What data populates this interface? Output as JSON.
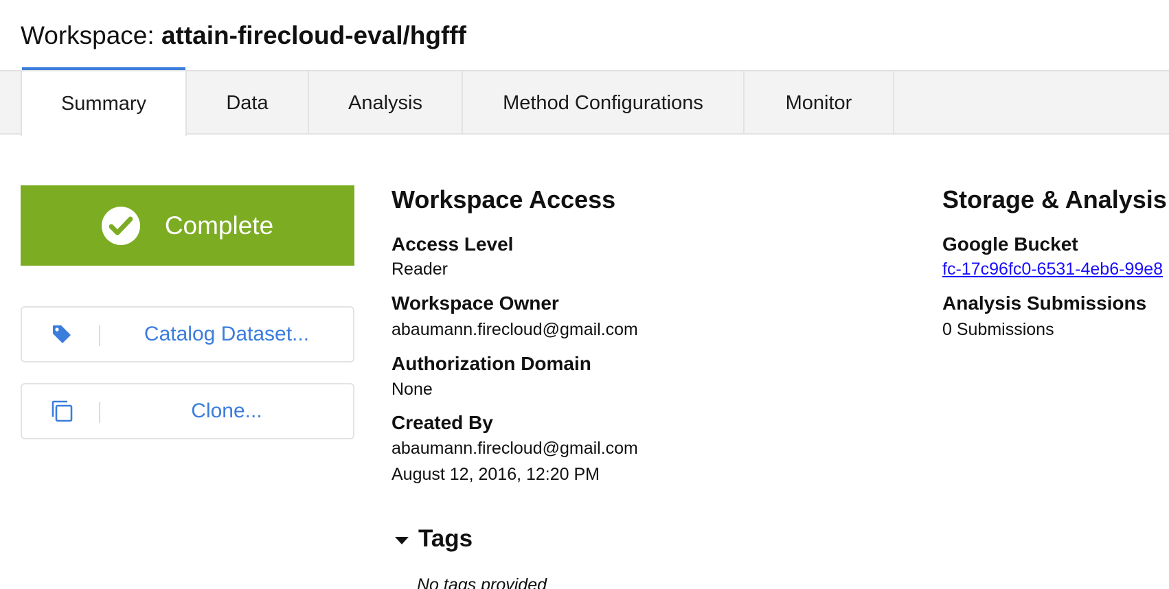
{
  "header": {
    "prefix": "Workspace: ",
    "workspace_name": "attain-firecloud-eval/hgfff"
  },
  "tabs": [
    {
      "label": "Summary",
      "active": true
    },
    {
      "label": "Data",
      "active": false
    },
    {
      "label": "Analysis",
      "active": false
    },
    {
      "label": "Method Configurations",
      "active": false
    },
    {
      "label": "Monitor",
      "active": false
    }
  ],
  "status": {
    "label": "Complete",
    "color": "#7cac22",
    "icon": "check-circle-icon"
  },
  "actions": {
    "catalog": {
      "label": "Catalog Dataset...",
      "icon": "tag-icon"
    },
    "clone": {
      "label": "Clone...",
      "icon": "copy-icon"
    }
  },
  "workspace_access": {
    "title": "Workspace Access",
    "access_level_label": "Access Level",
    "access_level_value": "Reader",
    "owner_label": "Workspace Owner",
    "owner_value": "abaumann.firecloud@gmail.com",
    "auth_domain_label": "Authorization Domain",
    "auth_domain_value": "None",
    "created_by_label": "Created By",
    "created_by_value": "abaumann.firecloud@gmail.com",
    "created_date": "August 12, 2016, 12:20 PM"
  },
  "storage": {
    "title": "Storage & Analysis",
    "bucket_label": "Google Bucket",
    "bucket_value": "fc-17c96fc0-6531-4eb6-99e8",
    "submissions_label": "Analysis Submissions",
    "submissions_value": "0 Submissions"
  },
  "tags": {
    "title": "Tags",
    "empty_text": "No tags provided"
  },
  "colors": {
    "accent": "#3b7ddd",
    "link": "#1a0dff",
    "success": "#7cac22"
  }
}
